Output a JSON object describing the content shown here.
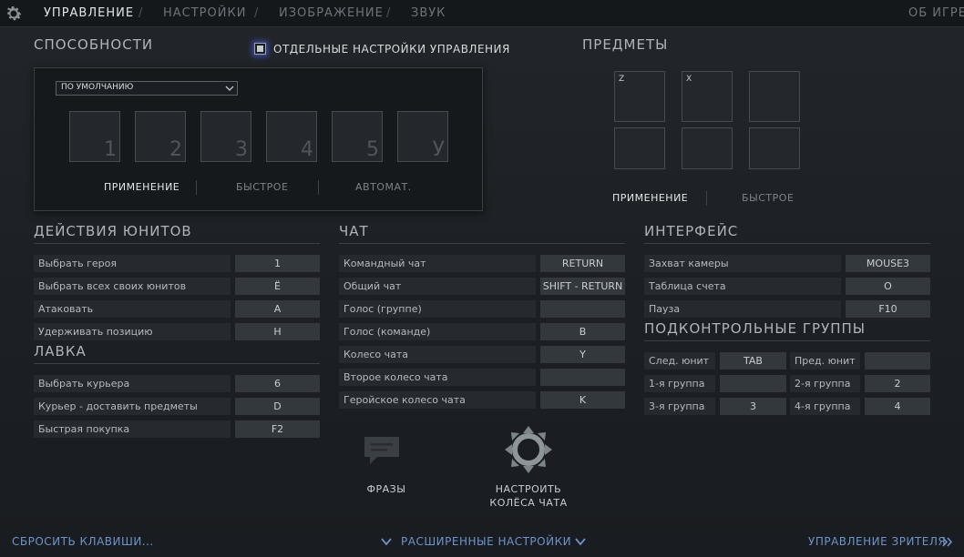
{
  "nav": {
    "tabs": [
      {
        "label": "УПРАВЛЕНИЕ",
        "active": true
      },
      {
        "label": "НАСТРОЙКИ",
        "active": false
      },
      {
        "label": "ИЗОБРАЖЕНИЕ",
        "active": false
      },
      {
        "label": "ЗВУК",
        "active": false
      }
    ],
    "separator": "/",
    "about": "ОБ ИГРЕ"
  },
  "abilities": {
    "title": "СПОСОБНОСТИ",
    "separate_settings_label": "ОТДЕЛЬНЫЕ НАСТРОЙКИ УПРАВЛЕНИЯ",
    "separate_settings_checked": true,
    "preset": "ПО УМОЛЧАНИЮ",
    "slots": [
      "1",
      "2",
      "3",
      "4",
      "5",
      "У"
    ],
    "modes": [
      "ПРИМЕНЕНИЕ",
      "БЫСТРОЕ",
      "АВТОМАТ."
    ],
    "active_mode": "ПРИМЕНЕНИЕ"
  },
  "items": {
    "title": "ПРЕДМЕТЫ",
    "slots": [
      "Z",
      "X",
      "",
      "",
      "",
      ""
    ],
    "modes": [
      "ПРИМЕНЕНИЕ",
      "БЫСТРОЕ"
    ],
    "active_mode": "ПРИМЕНЕНИЕ"
  },
  "unit_actions": {
    "title": "ДЕЙСТВИЯ ЮНИТОВ",
    "rows": [
      {
        "label": "Выбрать героя",
        "key": "1"
      },
      {
        "label": "Выбрать всех своих юнитов",
        "key": "Ё"
      },
      {
        "label": "Атаковать",
        "key": "A"
      },
      {
        "label": "Удерживать позицию",
        "key": "H"
      }
    ]
  },
  "shop": {
    "title": "ЛАВКА",
    "rows": [
      {
        "label": "Выбрать курьера",
        "key": "6"
      },
      {
        "label": "Курьер - доставить предметы",
        "key": "D"
      },
      {
        "label": "Быстрая покупка",
        "key": "F2"
      }
    ]
  },
  "chat": {
    "title": "ЧАТ",
    "rows": [
      {
        "label": "Командный чат",
        "key": "RETURN"
      },
      {
        "label": "Общий чат",
        "key": "SHIFT - RETURN"
      },
      {
        "label": "Голос (группе)",
        "key": ""
      },
      {
        "label": "Голос (команде)",
        "key": "B"
      },
      {
        "label": "Колесо чата",
        "key": "Y"
      },
      {
        "label": "Второе колесо чата",
        "key": ""
      },
      {
        "label": "Геройское колесо чата",
        "key": "K"
      }
    ],
    "phrases_label": "ФРАЗЫ",
    "wheel_label_1": "НАСТРОИТЬ",
    "wheel_label_2": "КОЛЁСА ЧАТА"
  },
  "interface": {
    "title": "ИНТЕРФЕЙС",
    "rows": [
      {
        "label": "Захват камеры",
        "key": "MOUSE3"
      },
      {
        "label": "Таблица счета",
        "key": "O"
      },
      {
        "label": "Пауза",
        "key": "F10"
      }
    ]
  },
  "control_groups": {
    "title": "ПОДКОНТРОЛЬНЫЕ ГРУППЫ",
    "rows": [
      [
        {
          "label": "След. юнит",
          "key": "TAB"
        },
        {
          "label": "Пред. юнит",
          "key": ""
        }
      ],
      [
        {
          "label": "1-я группа",
          "key": ""
        },
        {
          "label": "2-я группа",
          "key": "2"
        }
      ],
      [
        {
          "label": "3-я группа",
          "key": "3"
        },
        {
          "label": "4-я группа",
          "key": "4"
        }
      ]
    ]
  },
  "footer": {
    "reset": "СБРОСИТЬ КЛАВИШИ...",
    "advanced": "РАСШИРЕННЫЕ НАСТРОЙКИ",
    "spectator": "УПРАВЛЕНИЕ ЗРИТЕЛЯ"
  },
  "colors": {
    "accent_link": "#6d94c9",
    "checkbox_glow": "#3d4aa8"
  }
}
